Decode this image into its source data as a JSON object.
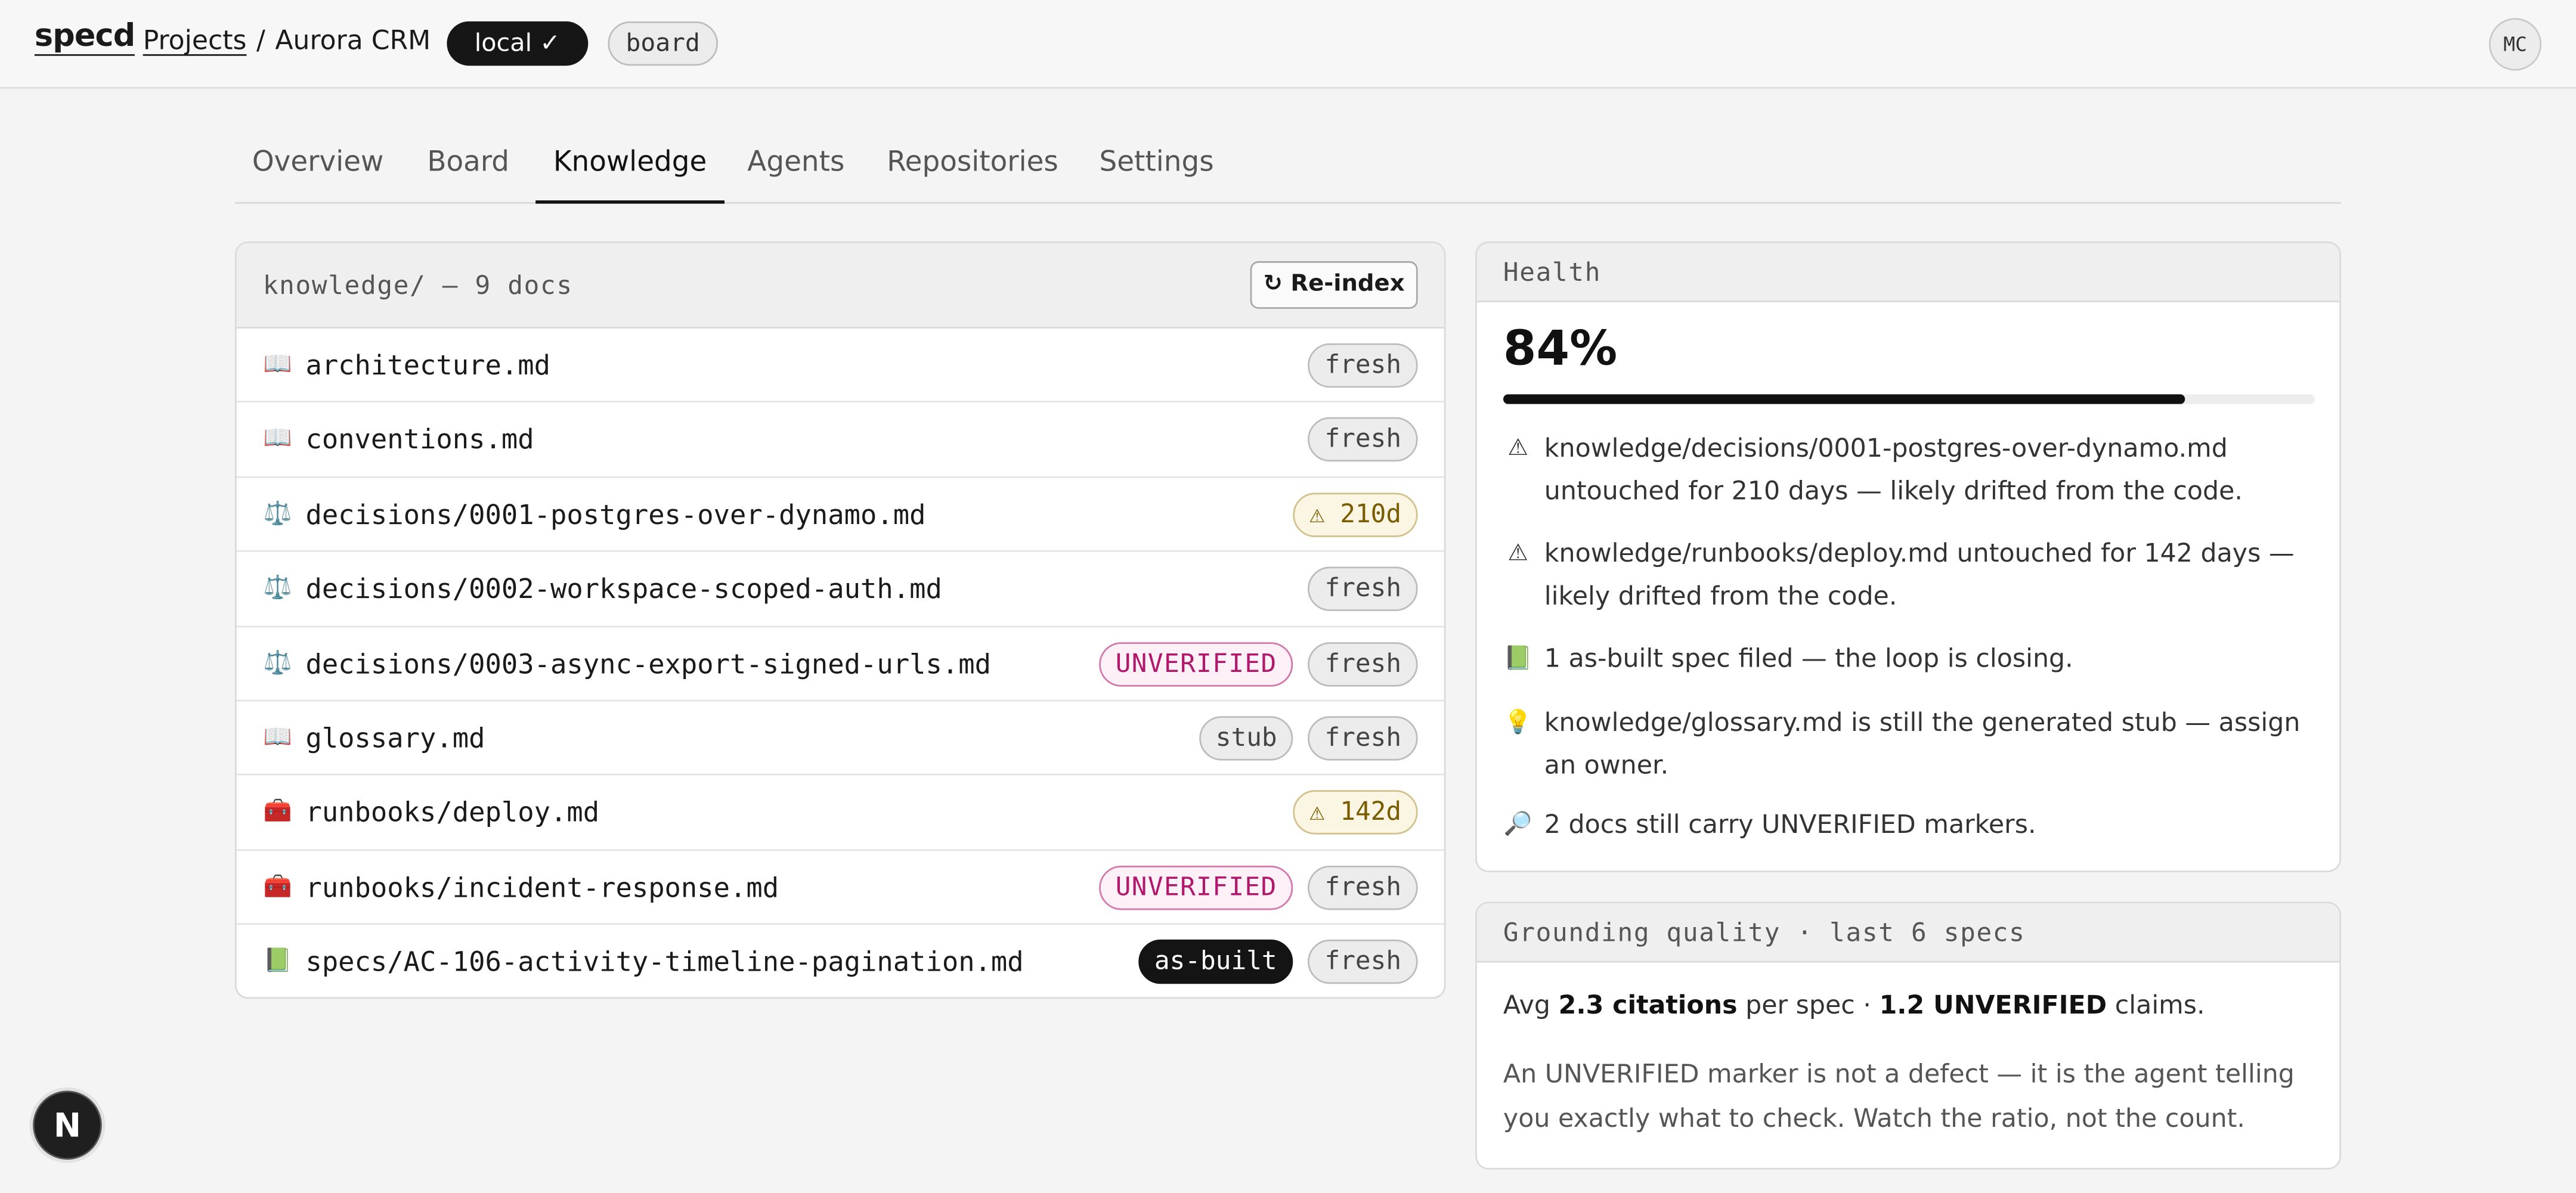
{
  "app": {
    "logo": "specd"
  },
  "breadcrumb": {
    "projects": "Projects",
    "sep": "/",
    "project": "Aurora CRM"
  },
  "env_pills": {
    "local": "local ✓",
    "board": "board"
  },
  "user": {
    "initials": "MC"
  },
  "tabs": [
    {
      "label": "Overview",
      "active": false
    },
    {
      "label": "Board",
      "active": false
    },
    {
      "label": "Knowledge",
      "active": true
    },
    {
      "label": "Agents",
      "active": false
    },
    {
      "label": "Repositories",
      "active": false
    },
    {
      "label": "Settings",
      "active": false
    }
  ],
  "knowledge": {
    "header": "knowledge/ — 9 docs",
    "reindex_label": "↻ Re-index",
    "docs": [
      {
        "icon": "📖",
        "icon_name": "book-icon",
        "name": "architecture.md",
        "badges": [
          {
            "text": "fresh",
            "kind": "fresh"
          }
        ]
      },
      {
        "icon": "📖",
        "icon_name": "book-icon",
        "name": "conventions.md",
        "badges": [
          {
            "text": "fresh",
            "kind": "fresh"
          }
        ]
      },
      {
        "icon": "⚖️",
        "icon_name": "scales-icon",
        "name": "decisions/0001-postgres-over-dynamo.md",
        "badges": [
          {
            "text": "⚠ 210d",
            "kind": "stale"
          }
        ]
      },
      {
        "icon": "⚖️",
        "icon_name": "scales-icon",
        "name": "decisions/0002-workspace-scoped-auth.md",
        "badges": [
          {
            "text": "fresh",
            "kind": "fresh"
          }
        ]
      },
      {
        "icon": "⚖️",
        "icon_name": "scales-icon",
        "name": "decisions/0003-async-export-signed-urls.md",
        "badges": [
          {
            "text": "UNVERIFIED",
            "kind": "unver"
          },
          {
            "text": "fresh",
            "kind": "fresh"
          }
        ]
      },
      {
        "icon": "📖",
        "icon_name": "book-icon",
        "name": "glossary.md",
        "badges": [
          {
            "text": "stub",
            "kind": "stub"
          },
          {
            "text": "fresh",
            "kind": "fresh"
          }
        ]
      },
      {
        "icon": "🧰",
        "icon_name": "toolbox-icon",
        "name": "runbooks/deploy.md",
        "badges": [
          {
            "text": "⚠ 142d",
            "kind": "stale"
          }
        ]
      },
      {
        "icon": "🧰",
        "icon_name": "toolbox-icon",
        "name": "runbooks/incident-response.md",
        "badges": [
          {
            "text": "UNVERIFIED",
            "kind": "unver"
          },
          {
            "text": "fresh",
            "kind": "fresh"
          }
        ]
      },
      {
        "icon": "📗",
        "icon_name": "green-book-icon",
        "name": "specs/AC-106-activity-timeline-pagination.md",
        "badges": [
          {
            "text": "as-built",
            "kind": "built"
          },
          {
            "text": "fresh",
            "kind": "fresh"
          }
        ]
      }
    ]
  },
  "health": {
    "title": "Health",
    "percent_label": "84%",
    "percent": 84,
    "items": [
      {
        "icon": "⚠",
        "icon_name": "warning-icon",
        "text": "knowledge/decisions/0001-postgres-over-dynamo.md untouched for 210 days — likely drifted from the code."
      },
      {
        "icon": "⚠",
        "icon_name": "warning-icon",
        "text": "knowledge/runbooks/deploy.md untouched for 142 days — likely drifted from the code."
      },
      {
        "icon": "📗",
        "icon_name": "green-book-icon",
        "text": "1 as-built spec filed — the loop is closing."
      },
      {
        "icon": "💡",
        "icon_name": "lightbulb-icon",
        "text": "knowledge/glossary.md is still the generated stub — assign an owner."
      },
      {
        "icon": "🔎",
        "icon_name": "magnifier-icon",
        "text": "2 docs still carry UNVERIFIED markers."
      }
    ]
  },
  "grounding": {
    "title": "Grounding quality · last 6 specs",
    "avg_prefix": "Avg",
    "citations": "2.3 citations",
    "per_spec": "per spec ·",
    "unverified": "1.2 UNVERIFIED",
    "claims": "claims.",
    "note": "An UNVERIFIED marker is not a defect — it is the agent telling you exactly what to check. Watch the ratio, not the count."
  },
  "dev_badge": {
    "label": "N"
  }
}
